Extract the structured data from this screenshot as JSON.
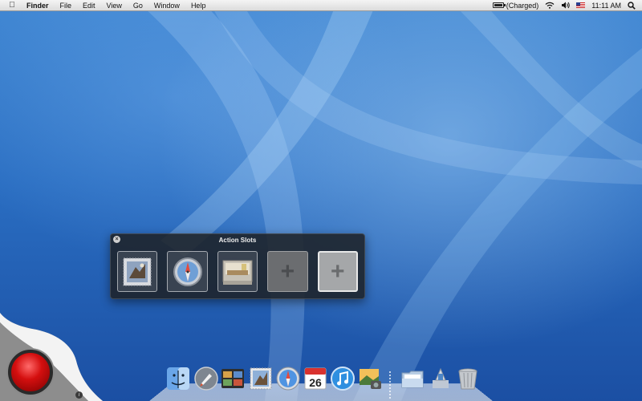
{
  "menubar": {
    "app_name": "Finder",
    "menus": [
      "File",
      "Edit",
      "View",
      "Go",
      "Window",
      "Help"
    ],
    "battery_status": "(Charged)",
    "clock": "11:11 AM"
  },
  "panel": {
    "title": "Action Slots",
    "slots": [
      {
        "icon": "mail-stamp-icon",
        "state": "filled"
      },
      {
        "icon": "safari-compass-icon",
        "state": "filled"
      },
      {
        "icon": "folder-desk-icon",
        "state": "filled"
      },
      {
        "icon": "plus-icon",
        "state": "empty"
      },
      {
        "icon": "plus-icon",
        "state": "empty-selected"
      }
    ],
    "plus_glyph": "+"
  },
  "dock": {
    "calendar_day": "26",
    "items": [
      "finder-icon",
      "rocket-icon",
      "photo-browser-icon",
      "mail-icon",
      "safari-icon",
      "calendar-icon",
      "itunes-icon",
      "iphoto-icon",
      "documents-folder-icon",
      "applications-stack-icon",
      "trash-icon"
    ]
  },
  "widget": {
    "info_glyph": "i"
  },
  "colors": {
    "accent_red": "#d40f0f",
    "desktop_blue": "#2a6ec2"
  }
}
